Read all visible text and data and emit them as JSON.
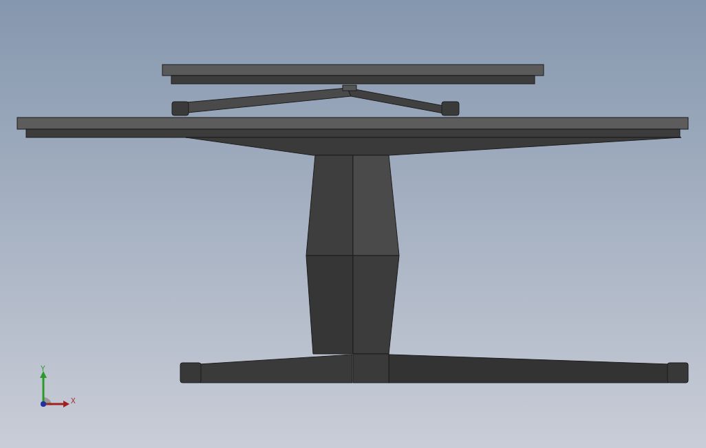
{
  "triad": {
    "x_label": "X",
    "y_label": "Y"
  }
}
